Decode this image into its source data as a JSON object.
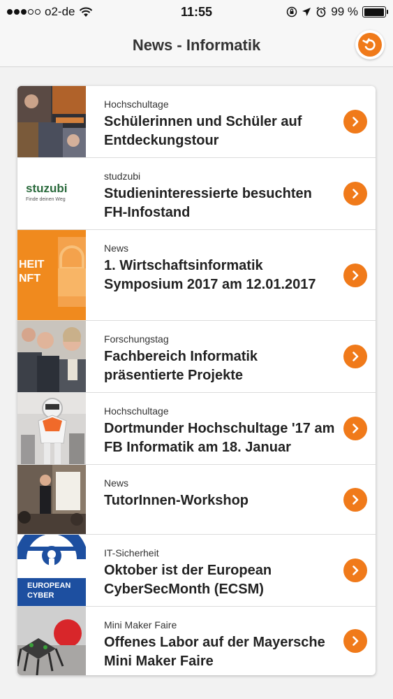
{
  "status_bar": {
    "carrier": "o2-de",
    "time": "11:55",
    "battery": "99 %",
    "battery_level": 0.99
  },
  "nav": {
    "title": "News - Informatik",
    "back_icon": "undo-arrow-icon"
  },
  "accent_color": "#f07a1a",
  "news": [
    {
      "category": "Hochschultage",
      "title": "Schülerinnen und Schüler auf Entdeckungstour"
    },
    {
      "category": "studzubi",
      "title": "Studieninteressierte besuchten FH-Infostand",
      "thumb_text": "stuzubi",
      "thumb_sub": "Finde deinen Weg"
    },
    {
      "category": "News",
      "title": "1. Wirtschaftsinformatik Symposium 2017 am 12.01.2017",
      "thumb_text": "HEIT\nNFT"
    },
    {
      "category": "Forschungstag",
      "title": "Fachbereich Informatik präsentierte Projekte"
    },
    {
      "category": "Hochschultage",
      "title": "Dortmunder Hochschultage '17 am FB Informatik am 18. Januar"
    },
    {
      "category": "News",
      "title": "TutorInnen-Workshop"
    },
    {
      "category": "IT-Sicherheit",
      "title": "Oktober ist der European CyberSecMonth (ECSM)",
      "thumb_text": "EUROPEAN",
      "thumb_text2": "CYBER"
    },
    {
      "category": "Mini Maker Faire",
      "title": "Offenes Labor auf der Mayersche Mini Maker Faire"
    }
  ]
}
